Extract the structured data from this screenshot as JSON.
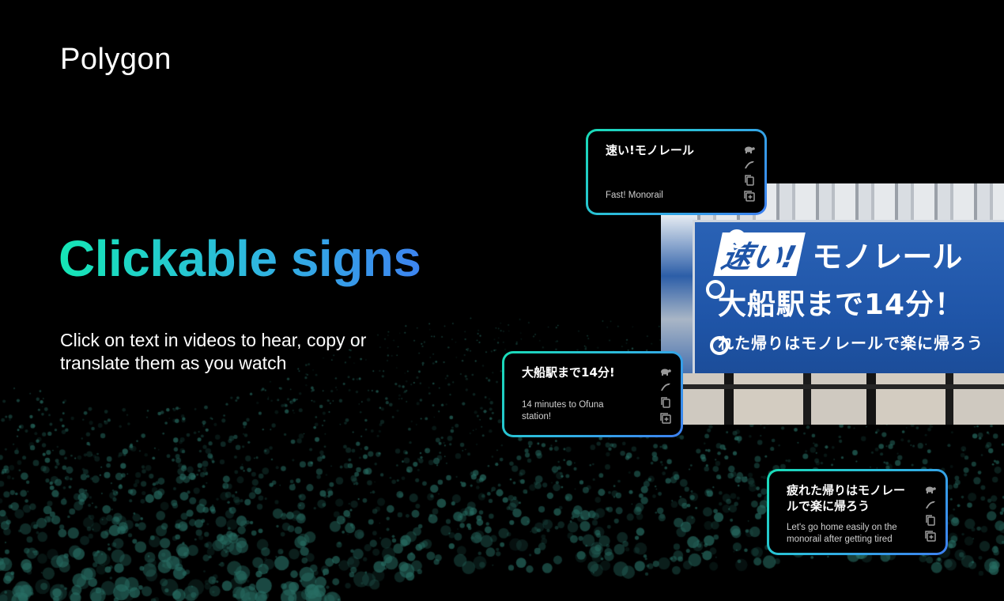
{
  "brand": {
    "logo": "Polygon"
  },
  "hero": {
    "headline": "Clickable signs",
    "subtitle": "Click on text in videos to hear, copy or translate them as you watch"
  },
  "video": {
    "sign_line1_box": "速い!",
    "sign_line1_rest": "モノレール",
    "sign_line2": "大船駅まで14分！",
    "sign_line3": "れた帰りはモノレールで楽に帰ろう"
  },
  "cards": [
    {
      "japanese": "速い!モノレール",
      "english": "Fast! Monorail"
    },
    {
      "japanese": "大船駅まで14分!",
      "english": "14 minutes to Ofuna station!"
    },
    {
      "japanese": "疲れた帰りはモノレールで楽に帰ろう",
      "english": "Let's go home easily on the monorail after getting tired"
    }
  ],
  "card_icons": [
    "turtle-icon",
    "dolphin-icon",
    "copy-icon",
    "add-icon"
  ],
  "colors": {
    "gradient_start": "#15e6b5",
    "gradient_mid": "#2fb6e0",
    "gradient_end": "#3d84f0",
    "background": "#000000"
  }
}
